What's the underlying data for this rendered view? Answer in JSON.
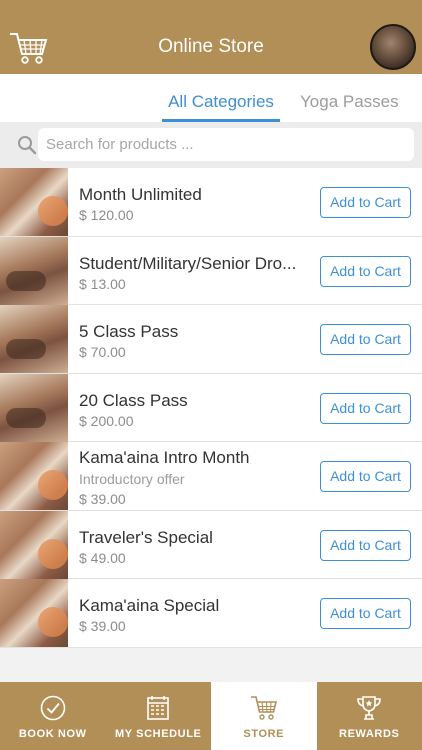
{
  "header": {
    "title": "Online Store",
    "cart_icon": "shopping-cart-icon",
    "avatar_icon": "profile-avatar"
  },
  "tabs": [
    {
      "label": "All Categories",
      "active": true
    },
    {
      "label": "Yoga Passes",
      "active": false
    }
  ],
  "search": {
    "placeholder": "Search for products ...",
    "value": "",
    "icon": "search-icon"
  },
  "products": [
    {
      "name": "Month Unlimited",
      "subtitle": "",
      "price": "$ 120.00",
      "button": "Add to Cart"
    },
    {
      "name": "Student/Military/Senior Dro...",
      "subtitle": "",
      "price": "$ 13.00",
      "button": "Add to Cart"
    },
    {
      "name": "5 Class Pass",
      "subtitle": "",
      "price": "$ 70.00",
      "button": "Add to Cart"
    },
    {
      "name": "20 Class Pass",
      "subtitle": "",
      "price": "$ 200.00",
      "button": "Add to Cart"
    },
    {
      "name": "Kama'aina Intro Month",
      "subtitle": "Introductory offer",
      "price": "$ 39.00",
      "button": "Add to Cart"
    },
    {
      "name": "Traveler's Special",
      "subtitle": "",
      "price": "$ 49.00",
      "button": "Add to Cart"
    },
    {
      "name": "Kama'aina Special",
      "subtitle": "",
      "price": "$ 39.00",
      "button": "Add to Cart"
    }
  ],
  "bottom_nav": [
    {
      "label": "BOOK NOW",
      "icon": "check-circle-icon",
      "active": false
    },
    {
      "label": "MY SCHEDULE",
      "icon": "calendar-icon",
      "active": false
    },
    {
      "label": "STORE",
      "icon": "shopping-cart-icon",
      "active": true
    },
    {
      "label": "REWARDS",
      "icon": "trophy-icon",
      "active": false
    }
  ],
  "colors": {
    "brand": "#b18f57",
    "accent": "#3f8fd6",
    "background": "#f2f2f2"
  }
}
